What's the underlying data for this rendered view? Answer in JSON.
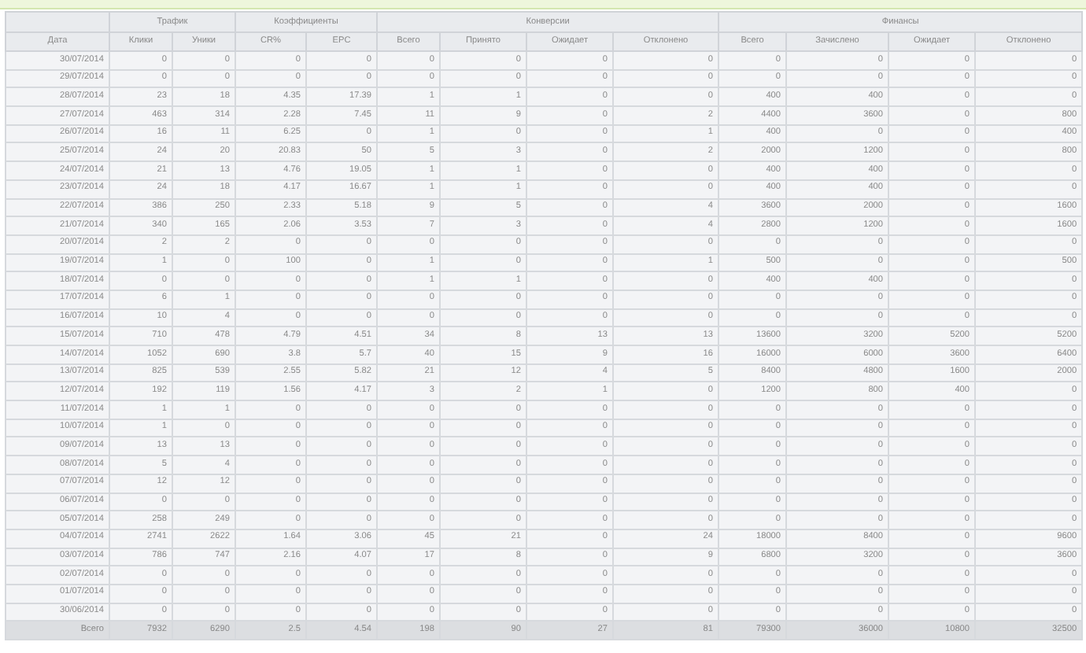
{
  "table": {
    "date_column": "Дата",
    "groups": [
      {
        "label": "Трафик",
        "columns": [
          "Клики",
          "Уники"
        ]
      },
      {
        "label": "Коэффициенты",
        "columns": [
          "CR%",
          "EPC"
        ]
      },
      {
        "label": "Конверсии",
        "columns": [
          "Всего",
          "Принято",
          "Ожидает",
          "Отклонено"
        ]
      },
      {
        "label": "Финансы",
        "columns": [
          "Всего",
          "Зачислено",
          "Ожидает",
          "Отклонено"
        ]
      }
    ],
    "rows": [
      [
        "30/07/2014",
        "0",
        "0",
        "0",
        "0",
        "0",
        "0",
        "0",
        "0",
        "0",
        "0",
        "0",
        "0"
      ],
      [
        "29/07/2014",
        "0",
        "0",
        "0",
        "0",
        "0",
        "0",
        "0",
        "0",
        "0",
        "0",
        "0",
        "0"
      ],
      [
        "28/07/2014",
        "23",
        "18",
        "4.35",
        "17.39",
        "1",
        "1",
        "0",
        "0",
        "400",
        "400",
        "0",
        "0"
      ],
      [
        "27/07/2014",
        "463",
        "314",
        "2.28",
        "7.45",
        "11",
        "9",
        "0",
        "2",
        "4400",
        "3600",
        "0",
        "800"
      ],
      [
        "26/07/2014",
        "16",
        "11",
        "6.25",
        "0",
        "1",
        "0",
        "0",
        "1",
        "400",
        "0",
        "0",
        "400"
      ],
      [
        "25/07/2014",
        "24",
        "20",
        "20.83",
        "50",
        "5",
        "3",
        "0",
        "2",
        "2000",
        "1200",
        "0",
        "800"
      ],
      [
        "24/07/2014",
        "21",
        "13",
        "4.76",
        "19.05",
        "1",
        "1",
        "0",
        "0",
        "400",
        "400",
        "0",
        "0"
      ],
      [
        "23/07/2014",
        "24",
        "18",
        "4.17",
        "16.67",
        "1",
        "1",
        "0",
        "0",
        "400",
        "400",
        "0",
        "0"
      ],
      [
        "22/07/2014",
        "386",
        "250",
        "2.33",
        "5.18",
        "9",
        "5",
        "0",
        "4",
        "3600",
        "2000",
        "0",
        "1600"
      ],
      [
        "21/07/2014",
        "340",
        "165",
        "2.06",
        "3.53",
        "7",
        "3",
        "0",
        "4",
        "2800",
        "1200",
        "0",
        "1600"
      ],
      [
        "20/07/2014",
        "2",
        "2",
        "0",
        "0",
        "0",
        "0",
        "0",
        "0",
        "0",
        "0",
        "0",
        "0"
      ],
      [
        "19/07/2014",
        "1",
        "0",
        "100",
        "0",
        "1",
        "0",
        "0",
        "1",
        "500",
        "0",
        "0",
        "500"
      ],
      [
        "18/07/2014",
        "0",
        "0",
        "0",
        "0",
        "1",
        "1",
        "0",
        "0",
        "400",
        "400",
        "0",
        "0"
      ],
      [
        "17/07/2014",
        "6",
        "1",
        "0",
        "0",
        "0",
        "0",
        "0",
        "0",
        "0",
        "0",
        "0",
        "0"
      ],
      [
        "16/07/2014",
        "10",
        "4",
        "0",
        "0",
        "0",
        "0",
        "0",
        "0",
        "0",
        "0",
        "0",
        "0"
      ],
      [
        "15/07/2014",
        "710",
        "478",
        "4.79",
        "4.51",
        "34",
        "8",
        "13",
        "13",
        "13600",
        "3200",
        "5200",
        "5200"
      ],
      [
        "14/07/2014",
        "1052",
        "690",
        "3.8",
        "5.7",
        "40",
        "15",
        "9",
        "16",
        "16000",
        "6000",
        "3600",
        "6400"
      ],
      [
        "13/07/2014",
        "825",
        "539",
        "2.55",
        "5.82",
        "21",
        "12",
        "4",
        "5",
        "8400",
        "4800",
        "1600",
        "2000"
      ],
      [
        "12/07/2014",
        "192",
        "119",
        "1.56",
        "4.17",
        "3",
        "2",
        "1",
        "0",
        "1200",
        "800",
        "400",
        "0"
      ],
      [
        "11/07/2014",
        "1",
        "1",
        "0",
        "0",
        "0",
        "0",
        "0",
        "0",
        "0",
        "0",
        "0",
        "0"
      ],
      [
        "10/07/2014",
        "1",
        "0",
        "0",
        "0",
        "0",
        "0",
        "0",
        "0",
        "0",
        "0",
        "0",
        "0"
      ],
      [
        "09/07/2014",
        "13",
        "13",
        "0",
        "0",
        "0",
        "0",
        "0",
        "0",
        "0",
        "0",
        "0",
        "0"
      ],
      [
        "08/07/2014",
        "5",
        "4",
        "0",
        "0",
        "0",
        "0",
        "0",
        "0",
        "0",
        "0",
        "0",
        "0"
      ],
      [
        "07/07/2014",
        "12",
        "12",
        "0",
        "0",
        "0",
        "0",
        "0",
        "0",
        "0",
        "0",
        "0",
        "0"
      ],
      [
        "06/07/2014",
        "0",
        "0",
        "0",
        "0",
        "0",
        "0",
        "0",
        "0",
        "0",
        "0",
        "0",
        "0"
      ],
      [
        "05/07/2014",
        "258",
        "249",
        "0",
        "0",
        "0",
        "0",
        "0",
        "0",
        "0",
        "0",
        "0",
        "0"
      ],
      [
        "04/07/2014",
        "2741",
        "2622",
        "1.64",
        "3.06",
        "45",
        "21",
        "0",
        "24",
        "18000",
        "8400",
        "0",
        "9600"
      ],
      [
        "03/07/2014",
        "786",
        "747",
        "2.16",
        "4.07",
        "17",
        "8",
        "0",
        "9",
        "6800",
        "3200",
        "0",
        "3600"
      ],
      [
        "02/07/2014",
        "0",
        "0",
        "0",
        "0",
        "0",
        "0",
        "0",
        "0",
        "0",
        "0",
        "0",
        "0"
      ],
      [
        "01/07/2014",
        "0",
        "0",
        "0",
        "0",
        "0",
        "0",
        "0",
        "0",
        "0",
        "0",
        "0",
        "0"
      ],
      [
        "30/06/2014",
        "0",
        "0",
        "0",
        "0",
        "0",
        "0",
        "0",
        "0",
        "0",
        "0",
        "0",
        "0"
      ]
    ],
    "total": [
      "Всего",
      "7932",
      "6290",
      "2.5",
      "4.54",
      "198",
      "90",
      "27",
      "81",
      "79300",
      "36000",
      "10800",
      "32500"
    ]
  }
}
